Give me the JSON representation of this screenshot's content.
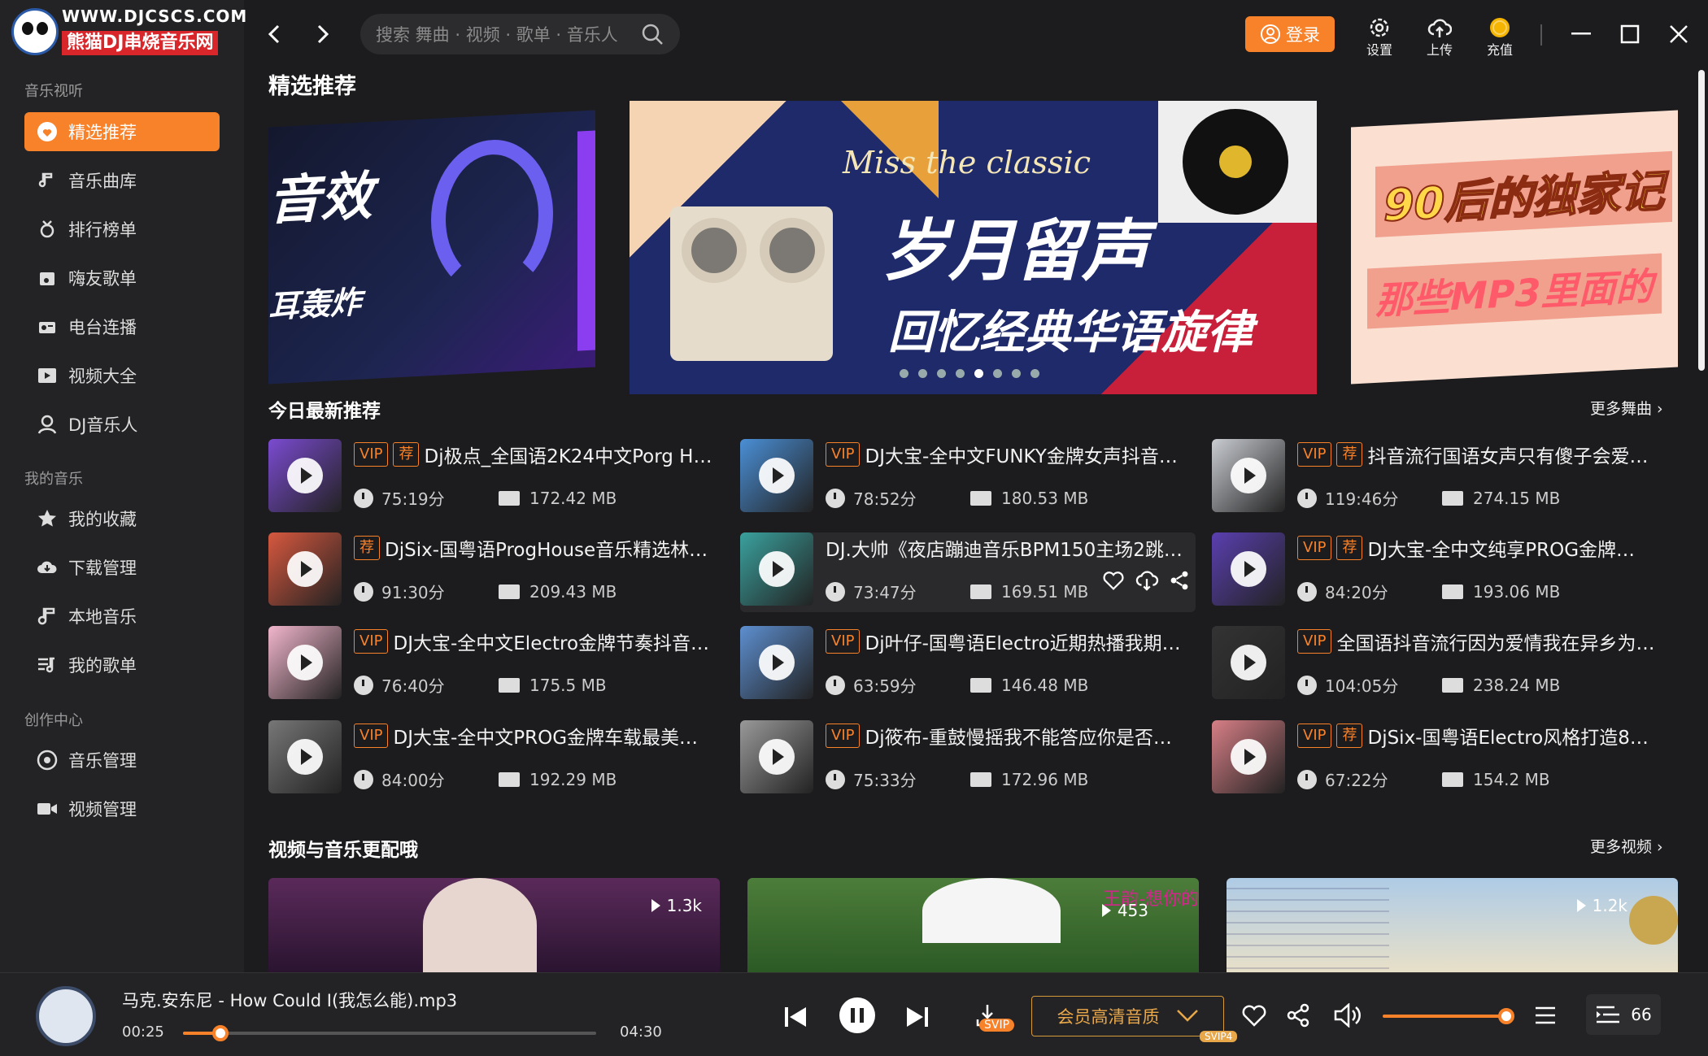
{
  "logo": {
    "url": "WWW.DJCSCS.COM",
    "name": "熊猫DJ串烧音乐网"
  },
  "sidebar": {
    "section_music": "音乐视听",
    "items_music": [
      {
        "label": "精选推荐",
        "icon": "heart-icon",
        "active": true
      },
      {
        "label": "音乐曲库",
        "icon": "music-note-icon"
      },
      {
        "label": "排行榜单",
        "icon": "trophy-icon"
      },
      {
        "label": "嗨友歌单",
        "icon": "playlist-icon"
      },
      {
        "label": "电台连播",
        "icon": "radio-icon"
      },
      {
        "label": "视频大全",
        "icon": "video-icon"
      },
      {
        "label": "DJ音乐人",
        "icon": "dj-icon"
      }
    ],
    "section_my": "我的音乐",
    "items_my": [
      {
        "label": "我的收藏",
        "icon": "star-icon"
      },
      {
        "label": "下载管理",
        "icon": "download-cloud-icon"
      },
      {
        "label": "本地音乐",
        "icon": "local-music-icon"
      },
      {
        "label": "我的歌单",
        "icon": "my-playlist-icon"
      }
    ],
    "section_create": "创作中心",
    "items_create": [
      {
        "label": "音乐管理",
        "icon": "music-manage-icon"
      },
      {
        "label": "视频管理",
        "icon": "camera-icon"
      }
    ]
  },
  "topbar": {
    "search_placeholder": "搜索 舞曲 · 视频 · 歌单 · 音乐人",
    "login": "登录",
    "settings": "设置",
    "upload": "上传",
    "recharge": "充值"
  },
  "main": {
    "title": "精选推荐",
    "banner_left_text1": "音效",
    "banner_left_text2": "耳轰炸",
    "banner_center_en": "Miss the classic",
    "banner_center_cn": "岁月留声",
    "banner_center_sub": "回忆经典华语旋律",
    "banner_right_text1": "90后的独家记",
    "banner_right_text2": "那些MP3里面的",
    "today_title": "今日最新推荐",
    "more_songs": "更多舞曲",
    "songs": [
      {
        "title": "Dj极点_全国语2K24中文Porg H…",
        "vip": true,
        "rec": true,
        "duration": "75:19分",
        "size": "172.42 MB",
        "color": "#7b4bd1"
      },
      {
        "title": "DJ大宝-全中文FUNKY金牌女声抖音…",
        "vip": true,
        "rec": false,
        "duration": "78:52分",
        "size": "180.53 MB",
        "color": "#4a8fd6"
      },
      {
        "title": "抖音流行国语女声只有傻子会爱…",
        "vip": true,
        "rec": true,
        "duration": "119:46分",
        "size": "274.15 MB",
        "color": "#c9ccd2"
      },
      {
        "title": "DjSix-国粤语ProgHouse音乐精选林…",
        "vip": false,
        "rec": true,
        "duration": "91:30分",
        "size": "209.43 MB",
        "color": "#d7583f"
      },
      {
        "title": "DJ.大帅《夜店蹦迪音乐BPM150主场2跳…",
        "vip": false,
        "rec": false,
        "duration": "73:47分",
        "size": "169.51 MB",
        "color": "#3aa19e",
        "hover": true
      },
      {
        "title": "DJ大宝-全中文纯享PROG金牌…",
        "vip": true,
        "rec": true,
        "duration": "84:20分",
        "size": "193.06 MB",
        "color": "#5a3fb0"
      },
      {
        "title": "DJ大宝-全中文Electro金牌节奏抖音…",
        "vip": true,
        "rec": false,
        "duration": "76:40分",
        "size": "175.5 MB",
        "color": "#f2b6cc"
      },
      {
        "title": "Dj叶仔-国粤语Electro近期热播我期…",
        "vip": true,
        "rec": false,
        "duration": "63:59分",
        "size": "146.48 MB",
        "color": "#5d8fd0"
      },
      {
        "title": "全国语抖音流行因为爱情我在异乡为…",
        "vip": true,
        "rec": false,
        "duration": "104:05分",
        "size": "238.24 MB",
        "color": "#333"
      },
      {
        "title": "DJ大宝-全中文PROG金牌车载最美…",
        "vip": true,
        "rec": false,
        "duration": "84:00分",
        "size": "192.29 MB",
        "color": "#777"
      },
      {
        "title": "Dj筱布-重鼓慢摇我不能答应你是否…",
        "vip": true,
        "rec": false,
        "duration": "75:33分",
        "size": "172.96 MB",
        "color": "#999"
      },
      {
        "title": "DjSix-国粤语Electro风格打造8…",
        "vip": true,
        "rec": true,
        "duration": "67:22分",
        "size": "154.2 MB",
        "color": "#d77f86"
      }
    ],
    "video_title": "视频与音乐更配哦",
    "more_videos": "更多视频",
    "videos": [
      {
        "count": "1.3k",
        "color": "#3a2040"
      },
      {
        "count": "453",
        "overlay": "王韵-想你的",
        "color": "#3d6b2f"
      },
      {
        "count": "1.2k",
        "color": "#8fb4d8"
      }
    ],
    "vip_label": "VIP",
    "rec_label": "荐"
  },
  "player": {
    "title": "马克.安东尼 - How Could I(我怎么能).mp3",
    "current": "00:25",
    "total": "04:30",
    "progress": 0.09,
    "quality": "会员高清音质",
    "svip": "SVIP",
    "svip4": "SVIP4",
    "volume": 1.0,
    "queue_count": "66"
  }
}
